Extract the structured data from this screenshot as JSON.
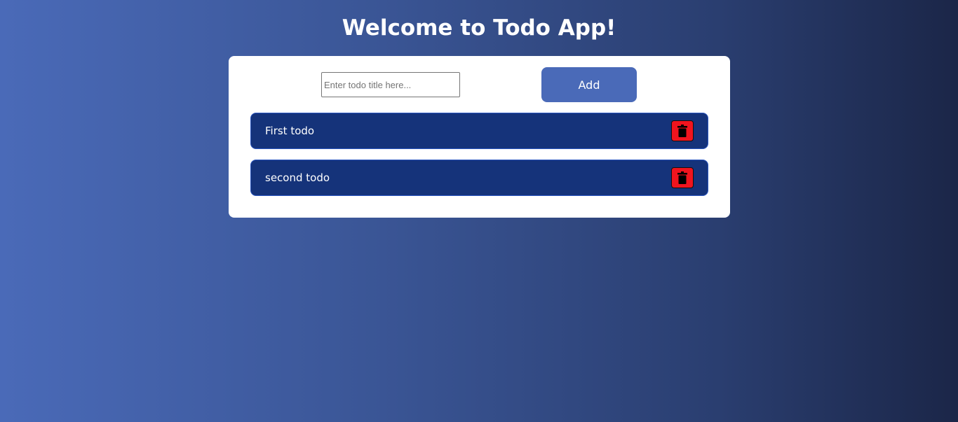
{
  "header": {
    "title": "Welcome to Todo App!"
  },
  "form": {
    "input_value": "",
    "input_placeholder": "Enter todo title here...",
    "add_label": "Add"
  },
  "todos": [
    {
      "title": "First todo",
      "icon": "trash-icon"
    },
    {
      "title": "second todo",
      "icon": "trash-icon"
    }
  ],
  "colors": {
    "accent": "#4a6ab8",
    "todo_background": "#15337a",
    "delete_background": "#f0141e",
    "card_background": "#ffffff"
  }
}
